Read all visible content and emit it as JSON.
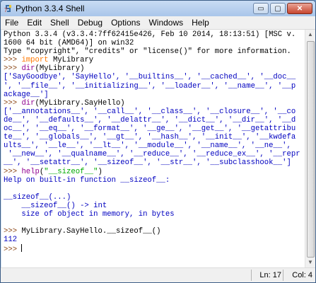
{
  "window": {
    "title": "Python 3.3.4 Shell"
  },
  "title_buttons": {
    "minimize": "▭",
    "maximize": "▢",
    "close": "✕"
  },
  "menu": [
    "File",
    "Edit",
    "Shell",
    "Debug",
    "Options",
    "Windows",
    "Help"
  ],
  "console": {
    "banner": [
      "Python 3.3.4 (v3.3.4:7ff62415e426, Feb 10 2014, 18:13:51) [MSC v.",
      "1600 64 bit (AMD64)] on win32",
      "Type \"copyright\", \"credits\" or \"license()\" for more information."
    ],
    "prompt": ">>> ",
    "cmd1": {
      "kw": "import",
      "rest": " MyLibrary"
    },
    "cmd2": {
      "fn": "dir",
      "rest": "(MyLibrary)"
    },
    "out2": [
      "['SayGoodbye', 'SayHello', '__builtins__', '__cached__', '__doc__",
      "', '__file__', '__initializing__', '__loader__', '__name__', '__p",
      "ackage__']"
    ],
    "cmd3": {
      "fn": "dir",
      "rest": "(MyLibrary.SayHello)"
    },
    "out3": [
      "['__annotations__', '__call__', '__class__', '__closure__', '__co",
      "de__', '__defaults__', '__delattr__', '__dict__', '__dir__', '__d",
      "oc__', '__eq__', '__format__', '__ge__', '__get__', '__getattribu",
      "te__', '__globals__', '__gt__', '__hash__', '__init__', '__kwdefa",
      "ults__', '__le__', '__lt__', '__module__', '__name__', '__ne__',",
      " '__new__', '__qualname__', '__reduce__', '__reduce_ex__', '__repr",
      "__', '__setattr__', '__sizeof__', '__str__', '__subclasshook__']"
    ],
    "cmd4": {
      "fn": "help",
      "open": "(",
      "arg": "\"__sizeof__\"",
      "close": ")"
    },
    "out4": [
      "Help on built-in function __sizeof__:",
      "",
      "__sizeof__(...)",
      "    __sizeof__() -> int",
      "    size of object in memory, in bytes",
      ""
    ],
    "cmd5": {
      "rest": "MyLibrary.SayHello.__sizeof__()"
    },
    "out5": "112",
    "current_input": ""
  },
  "status": {
    "line": "Ln: 17",
    "col": "Col: 4"
  }
}
